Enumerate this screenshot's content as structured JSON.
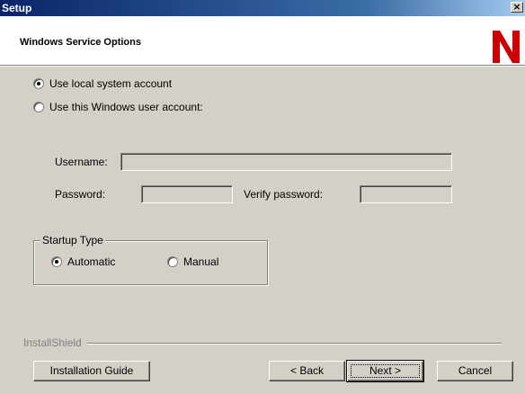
{
  "window": {
    "title": "Setup",
    "close_glyph": "×"
  },
  "header": {
    "heading": "Windows Service Options",
    "logo_letter": "N",
    "logo_color": "#cc0000"
  },
  "account": {
    "option_local": "Use local system account",
    "option_local_checked": true,
    "option_user": "Use this Windows user account:",
    "option_user_checked": false
  },
  "credentials": {
    "username_label": "Username:",
    "username_value": "",
    "password_label": "Password:",
    "password_value": "",
    "verify_label": "Verify password:",
    "verify_value": ""
  },
  "startup": {
    "legend": "Startup Type",
    "automatic": "Automatic",
    "automatic_checked": true,
    "manual": "Manual",
    "manual_checked": false
  },
  "footer": {
    "brand": "InstallShield",
    "guide_button": "Installation Guide",
    "back_button": "< Back",
    "next_button": "Next >",
    "cancel_button": "Cancel"
  },
  "colors": {
    "dialog_face": "#d4d0c8",
    "title_start": "#0a246a",
    "title_end": "#a6caf0"
  }
}
